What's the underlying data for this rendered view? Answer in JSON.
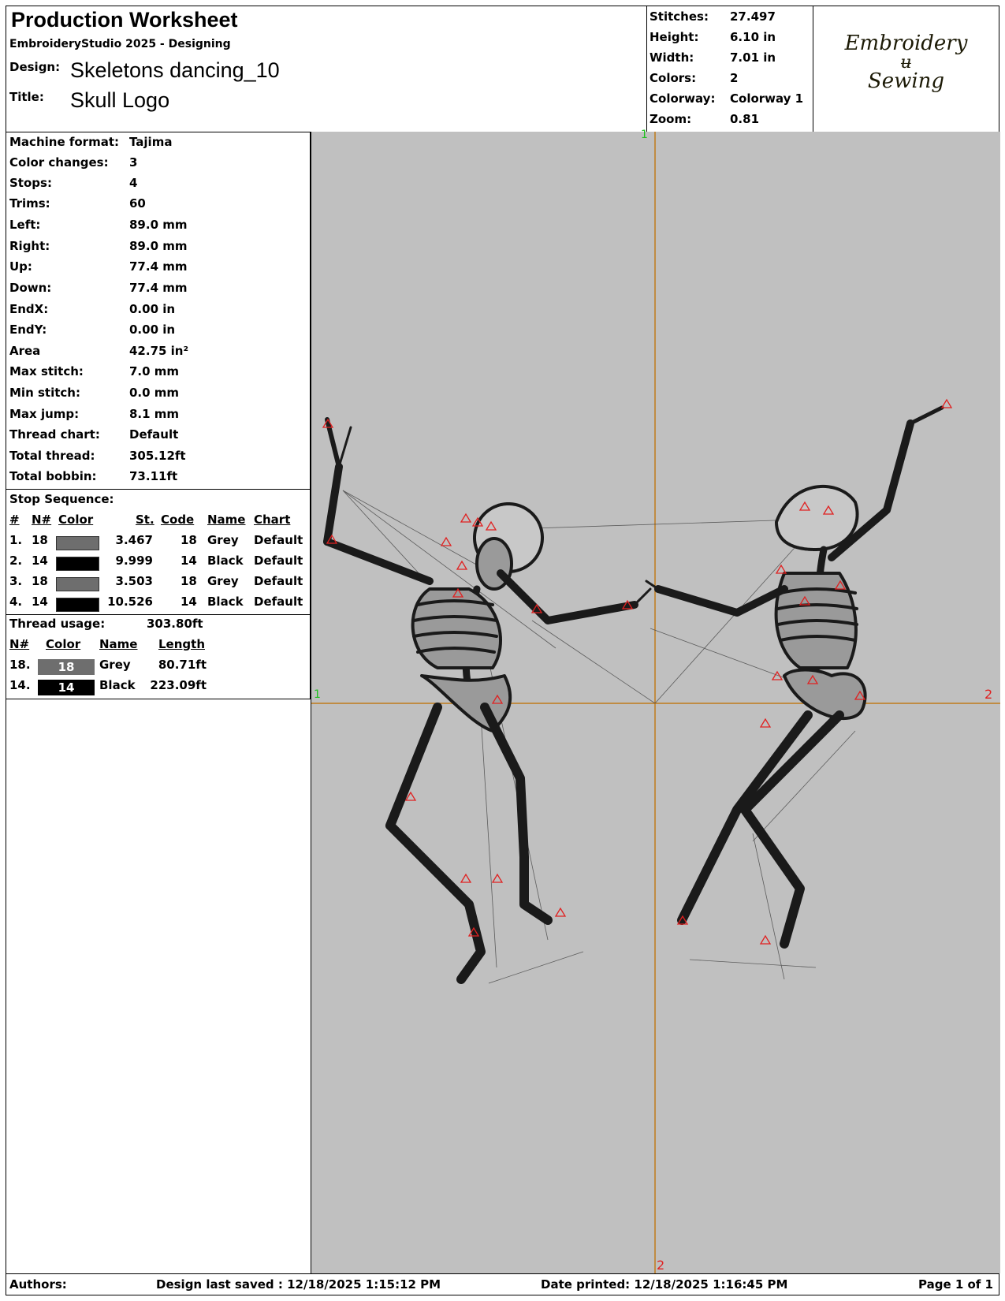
{
  "header": {
    "title": "Production Worksheet",
    "software": "EmbroideryStudio 2025 - Designing",
    "design_label": "Design:",
    "design_value": "Skeletons dancing_10",
    "title_label": "Title:",
    "title_value": "Skull Logo"
  },
  "summary": [
    {
      "label": "Stitches:",
      "value": "27.497"
    },
    {
      "label": "Height:",
      "value": "6.10 in"
    },
    {
      "label": "Width:",
      "value": "7.01 in"
    },
    {
      "label": "Colors:",
      "value": "2"
    },
    {
      "label": "Colorway:",
      "value": "Colorway 1"
    },
    {
      "label": "Zoom:",
      "value": "0.81"
    }
  ],
  "logo": {
    "line1": "Embroidery",
    "line2": "ʉ",
    "line3": "Sewing",
    "color": "#1c1a06"
  },
  "details": [
    {
      "label": "Machine format:",
      "value": "Tajima"
    },
    {
      "label": "Color changes:",
      "value": "3"
    },
    {
      "label": "Stops:",
      "value": "4"
    },
    {
      "label": "Trims:",
      "value": "60"
    },
    {
      "label": "Left:",
      "value": "89.0 mm"
    },
    {
      "label": "Right:",
      "value": "89.0 mm"
    },
    {
      "label": "Up:",
      "value": "77.4 mm"
    },
    {
      "label": "Down:",
      "value": "77.4 mm"
    },
    {
      "label": "EndX:",
      "value": "0.00 in"
    },
    {
      "label": "EndY:",
      "value": "0.00 in"
    },
    {
      "label": "Area",
      "value": " 42.75 in²"
    },
    {
      "label": "Max stitch:",
      "value": "7.0 mm"
    },
    {
      "label": "Min stitch:",
      "value": "0.0 mm"
    },
    {
      "label": "Max jump:",
      "value": "8.1 mm"
    },
    {
      "label": "Thread chart:",
      "value": "Default"
    },
    {
      "label": "Total thread:",
      "value": "305.12ft"
    },
    {
      "label": "Total bobbin:",
      "value": "73.11ft"
    }
  ],
  "stop_sequence": {
    "heading": "Stop Sequence:",
    "columns": [
      "#",
      "N#",
      "Color",
      "St.",
      "Code",
      "Name",
      "Chart"
    ],
    "rows": [
      {
        "num": "1.",
        "n": "18",
        "color": "#6e6e6e",
        "st": "3.467",
        "code": "18",
        "name": "Grey",
        "chart": "Default"
      },
      {
        "num": "2.",
        "n": "14",
        "color": "#000000",
        "st": "9.999",
        "code": "14",
        "name": "Black",
        "chart": "Default"
      },
      {
        "num": "3.",
        "n": "18",
        "color": "#6e6e6e",
        "st": "3.503",
        "code": "18",
        "name": "Grey",
        "chart": "Default"
      },
      {
        "num": "4.",
        "n": "14",
        "color": "#000000",
        "st": "10.526",
        "code": "14",
        "name": "Black",
        "chart": "Default"
      }
    ]
  },
  "thread_usage": {
    "label": "Thread usage:",
    "value": "303.80ft",
    "columns": [
      "N#",
      "Color",
      "Name",
      "Length"
    ],
    "rows": [
      {
        "n": "18.",
        "swatch_text": "18",
        "color": "#6e6e6e",
        "name": "Grey",
        "length": "80.71ft"
      },
      {
        "n": "14.",
        "swatch_text": "14",
        "color": "#000000",
        "name": "Black",
        "length": "223.09ft"
      }
    ]
  },
  "preview": {
    "background": "#c0c0c0",
    "axis_color": "#c07a1a",
    "marker_color": "#e02020",
    "axis_labels": {
      "top": "1",
      "left": "1",
      "right": "2",
      "bottom": "2"
    }
  },
  "footer": {
    "authors_label": "Authors:",
    "saved": "Design last saved : 12/18/2025 1:15:12 PM",
    "printed": "Date printed: 12/18/2025 1:16:45 PM",
    "page": "Page 1 of 1"
  }
}
